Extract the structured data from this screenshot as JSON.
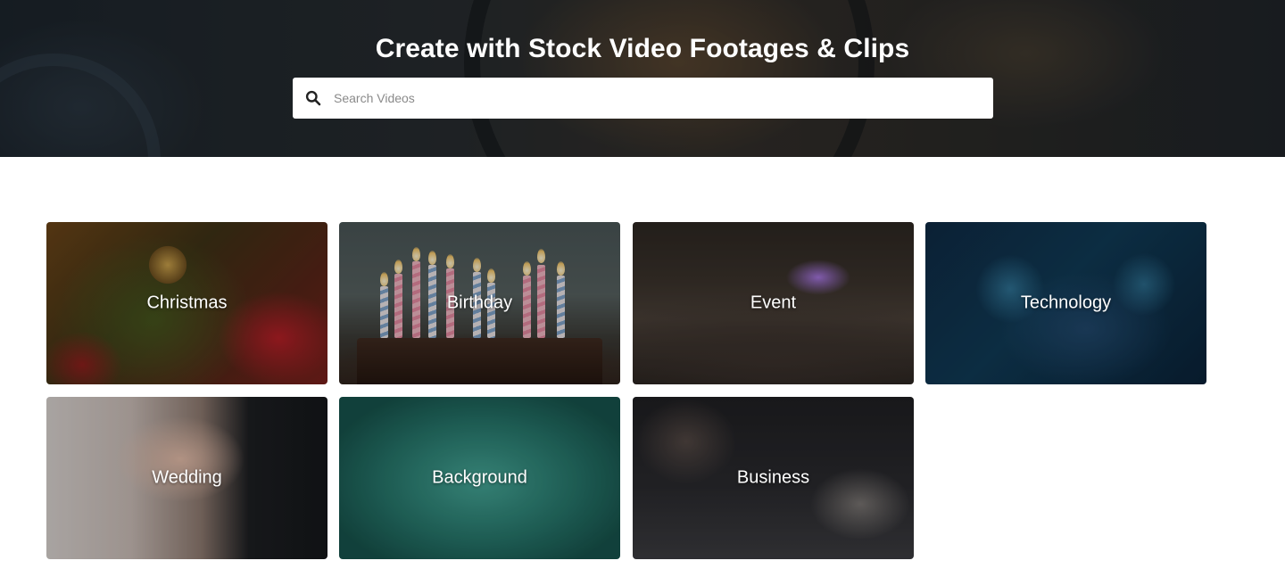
{
  "hero": {
    "title": "Create with Stock Video Footages & Clips"
  },
  "search": {
    "placeholder": "Search Videos",
    "icon": "search-icon"
  },
  "categories": [
    {
      "label": "Christmas"
    },
    {
      "label": "Birthday"
    },
    {
      "label": "Event"
    },
    {
      "label": "Technology"
    },
    {
      "label": "Wedding"
    },
    {
      "label": "Background"
    },
    {
      "label": "Business"
    }
  ]
}
